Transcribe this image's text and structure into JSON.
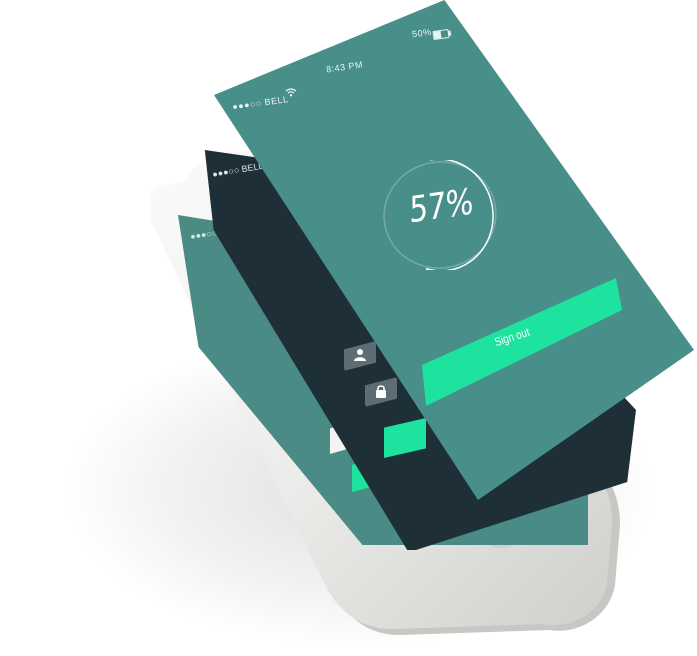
{
  "front_screen": {
    "carrier": "●●●○○ BELL",
    "time": "8:43 PM",
    "battery_percent_label": "50%",
    "battery_level": 0.5,
    "progress_label": "57%",
    "progress_value": 0.57,
    "signout_label": "Sign out"
  },
  "mid_screen": {
    "carrier": "●●●○○ BELL"
  },
  "back_screen": {
    "carrier": "●●●○○ BELL"
  },
  "colors": {
    "teal_screen": "#488e89",
    "dark_screen": "#1f2f37",
    "accent_green": "#1de39e",
    "phone_silver": "#e9e9e6"
  },
  "icons": {
    "user": "user-icon",
    "lock": "lock-icon",
    "wifi": "wifi-icon",
    "battery": "battery-icon"
  }
}
